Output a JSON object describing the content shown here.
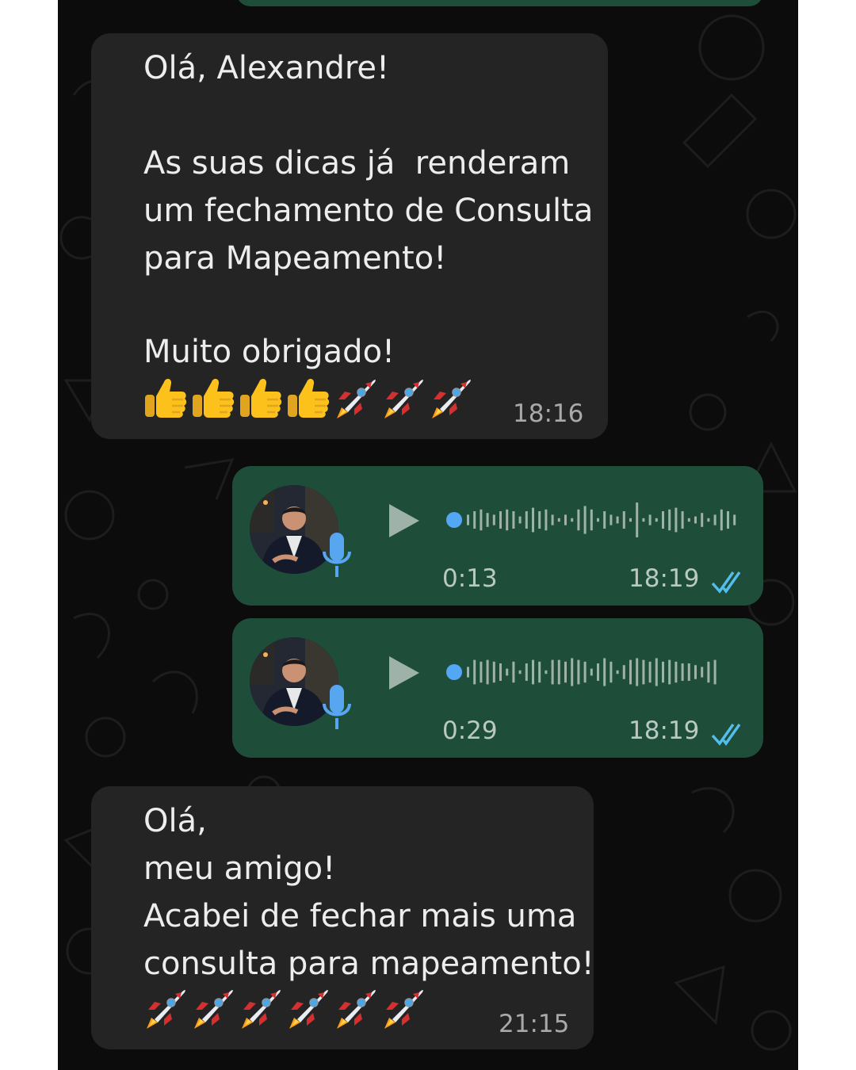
{
  "colors": {
    "chat_background": "#0c0c0c",
    "incoming_bubble": "#242424",
    "outgoing_bubble": "#1e4d3a",
    "read_ticks": "#53bdeb",
    "audio_dot": "#53a7f5"
  },
  "messages": {
    "m1": {
      "lines": [
        "Olá, Alexandre!",
        "",
        "As suas dicas já  renderam",
        "um fechamento de Consulta",
        "para Mapeamento!",
        "",
        "Muito obrigado!"
      ],
      "emojis": [
        "thumbs-up",
        "thumbs-up",
        "thumbs-up",
        "thumbs-up",
        "rocket",
        "rocket",
        "rocket"
      ],
      "time": "18:16"
    },
    "a1": {
      "duration": "0:13",
      "time": "18:19",
      "status_icon": "double-check-read-icon"
    },
    "a2": {
      "duration": "0:29",
      "time": "18:19",
      "status_icon": "double-check-read-icon"
    },
    "m2": {
      "lines": [
        "Olá,",
        "meu amigo!",
        "Acabei de fechar mais uma",
        "consulta para mapeamento!"
      ],
      "emojis": [
        "rocket",
        "rocket",
        "rocket",
        "rocket",
        "rocket",
        "rocket"
      ],
      "time": "21:15"
    }
  }
}
